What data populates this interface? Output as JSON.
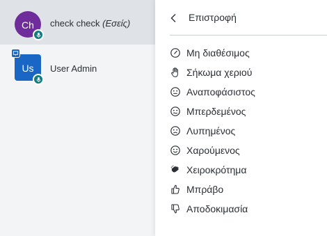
{
  "users": [
    {
      "initials": "Ch",
      "name": "check check",
      "suffix": "(Εσείς)",
      "avatar_shape": "circle",
      "avatar_color": "#6f2c9b",
      "mic": true,
      "selected": true
    },
    {
      "initials": "Us",
      "name": "User Admin",
      "suffix": "",
      "avatar_shape": "square",
      "avatar_color": "#1a66c4",
      "mic": true,
      "presenter": true
    }
  ],
  "menu": {
    "back_label": "Επιστροφή",
    "items": [
      {
        "label": "Μη διαθέσιμος",
        "icon": "away-clock-icon"
      },
      {
        "label": "Σήκωμα χεριού",
        "icon": "raise-hand-icon"
      },
      {
        "label": "Αναποφάσιστος",
        "icon": "neutral-face-icon"
      },
      {
        "label": "Μπερδεμένος",
        "icon": "confused-face-icon"
      },
      {
        "label": "Λυπημένος",
        "icon": "sad-face-icon"
      },
      {
        "label": "Χαρούμενος",
        "icon": "happy-face-icon"
      },
      {
        "label": "Χειροκρότημα",
        "icon": "applause-icon"
      },
      {
        "label": "Μπράβο",
        "icon": "thumbs-up-icon"
      },
      {
        "label": "Αποδοκιμασία",
        "icon": "thumbs-down-icon"
      }
    ]
  },
  "colors": {
    "panel_bg": "#f3f4f6",
    "selected_bg": "#dfe3e8",
    "mic_badge": "#0f7d82",
    "text": "#2a2f35"
  }
}
